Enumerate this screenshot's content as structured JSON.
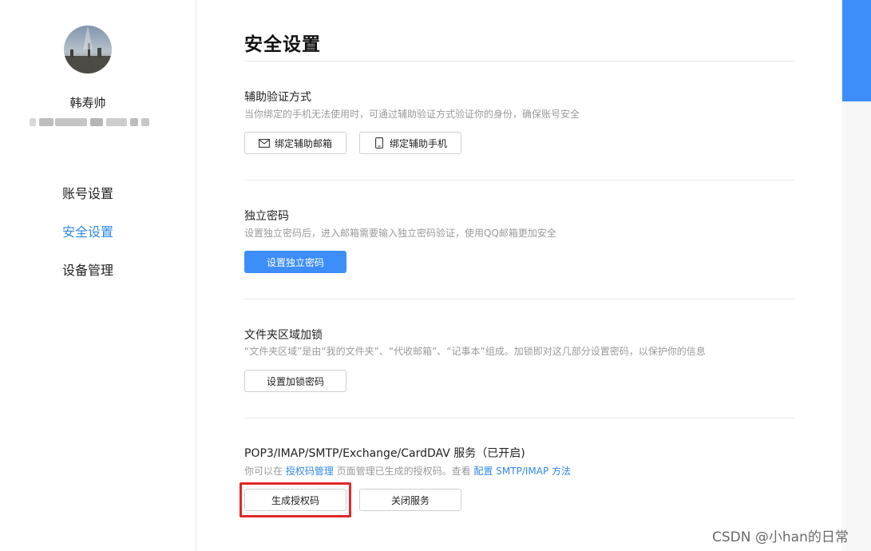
{
  "sidebar": {
    "user_name": "韩寿帅",
    "user_email": "██████████████",
    "nav": [
      {
        "label": "账号设置"
      },
      {
        "label": "安全设置"
      },
      {
        "label": "设备管理"
      }
    ]
  },
  "page": {
    "title": "安全设置"
  },
  "sections": {
    "aux_verify": {
      "title": "辅助验证方式",
      "desc": "当你绑定的手机无法使用时，可通过辅助验证方式验证你的身份，确保账号安全",
      "btn_email": "绑定辅助邮箱",
      "btn_phone": "绑定辅助手机"
    },
    "independent_password": {
      "title": "独立密码",
      "desc": "设置独立密码后，进入邮箱需要输入独立密码验证，使用QQ邮箱更加安全",
      "btn": "设置独立密码"
    },
    "folder_lock": {
      "title": "文件夹区域加锁",
      "desc": "“文件夹区域”是由“我的文件夹”、“代收邮箱”、“记事本”组成。加锁即对这几部分设置密码，以保护你的信息",
      "btn": "设置加锁密码"
    },
    "pop3": {
      "title": "POP3/IMAP/SMTP/Exchange/CardDAV 服务（已开启)",
      "desc_prefix": "你可以在 ",
      "desc_link1": "授权码管理",
      "desc_middle": " 页面管理已生成的授权码。查看 ",
      "desc_link2": "配置 SMTP/IMAP 方法",
      "btn_generate": "生成授权码",
      "btn_close": "关闭服务"
    }
  },
  "watermark": "CSDN @小han的日常",
  "colors": {
    "accent": "#3d8ef8",
    "active_nav": "#2e88e8",
    "highlight": "#e02828"
  },
  "icons": {
    "email": "envelope-icon",
    "phone": "mobile-phone-icon"
  }
}
